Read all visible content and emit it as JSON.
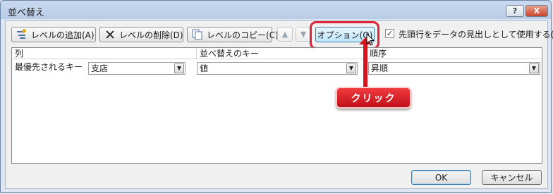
{
  "window": {
    "title": "並べ替え",
    "help_label": "?",
    "close_label": "X"
  },
  "toolbar": {
    "add_level": "レベルの追加(A)",
    "delete_level": "レベルの削除(D)",
    "copy_level": "レベルのコピー(C)",
    "move_up": "▲",
    "move_down": "▼",
    "options": "オプション(O)",
    "header_checkbox_label": "先頭行をデータの見出しとして使用する(H)",
    "header_checkbox_checked": "✓"
  },
  "grid": {
    "headers": [
      "列",
      "並べ替えのキー",
      "順序"
    ],
    "row": {
      "label": "最優先されるキー",
      "column_value": "支店",
      "key_value": "値",
      "order_value": "昇順"
    },
    "dropdown_arrow": "▼"
  },
  "footer": {
    "ok": "OK",
    "cancel": "キャンセル"
  },
  "annotation": {
    "callout_text": "クリック",
    "color": "#d8141d"
  }
}
